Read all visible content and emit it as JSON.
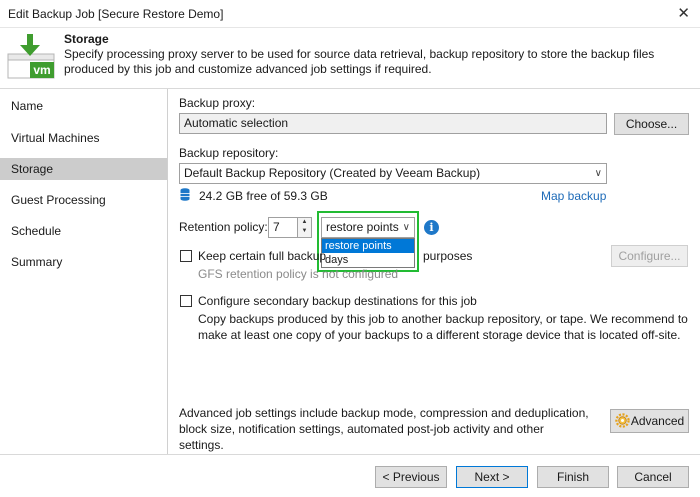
{
  "window": {
    "title": "Edit Backup Job [Secure Restore Demo]",
    "close_glyph": "✕"
  },
  "header": {
    "title": "Storage",
    "description": "Specify processing proxy server to be used for source data retrieval, backup repository to store the backup files produced by this job and customize advanced job settings if required.",
    "logo_text": "vm"
  },
  "sidebar": {
    "items": [
      {
        "label": "Name"
      },
      {
        "label": "Virtual Machines"
      },
      {
        "label": "Storage"
      },
      {
        "label": "Guest Processing"
      },
      {
        "label": "Schedule"
      },
      {
        "label": "Summary"
      }
    ],
    "active_index": 2
  },
  "storage": {
    "proxy_label": "Backup proxy:",
    "proxy_value": "Automatic selection",
    "choose_label": "Choose...",
    "repo_label": "Backup repository:",
    "repo_value": "Default Backup Repository (Created by Veeam Backup)",
    "free_space": "24.2 GB free of 59.3 GB",
    "map_backup": "Map backup",
    "retention_label": "Retention policy:",
    "retention_value": "7",
    "retention_unit": "restore points",
    "retention_options": [
      "restore points",
      "days"
    ],
    "selected_option_index": 0,
    "gfs_label_left": "Keep certain full backup",
    "gfs_label_right": "purposes",
    "gfs_note": "GFS retention policy is not configured",
    "gfs_checked": false,
    "configure_label": "Configure...",
    "secondary_label": "Configure secondary backup destinations for this job",
    "secondary_checked": false,
    "secondary_desc": "Copy backups produced by this job to another backup repository, or tape. We recommend to make at least one copy of your backups to a different storage device that is located off-site.",
    "advanced_desc": "Advanced job settings include backup mode, compression and deduplication, block size, notification settings, automated post-job activity and other settings.",
    "advanced_label": "Advanced"
  },
  "footer": {
    "previous_label": "< Previous",
    "next_label": "Next >",
    "finish_label": "Finish",
    "cancel_label": "Cancel"
  },
  "colors": {
    "highlight": "#22bb33",
    "selection": "#0078d7",
    "link": "#1e6bb8",
    "info": "#1e78c8"
  }
}
